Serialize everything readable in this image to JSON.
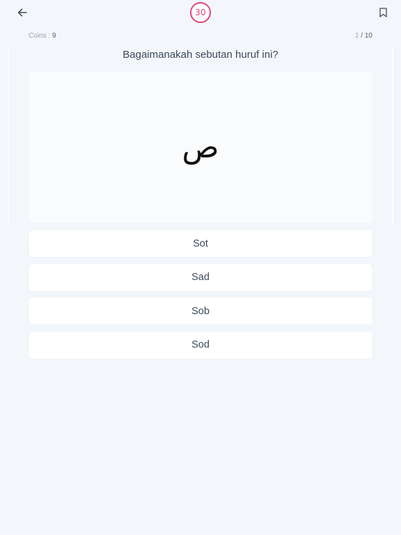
{
  "header": {
    "timer_value": "30",
    "back_icon": "arrow-left-icon",
    "bookmark_icon": "bookmark-icon",
    "timer_color": "#e2457a"
  },
  "stats": {
    "coins_label": "Coins : ",
    "coins_value": "9",
    "current_question": "1",
    "separator": " / ",
    "total_questions": "10"
  },
  "quiz": {
    "question": "Bagaimanakah sebutan huruf ini?",
    "letter": "ص",
    "options": [
      {
        "label": "Sot"
      },
      {
        "label": "Sad"
      },
      {
        "label": "Sob"
      },
      {
        "label": "Sod"
      }
    ]
  }
}
